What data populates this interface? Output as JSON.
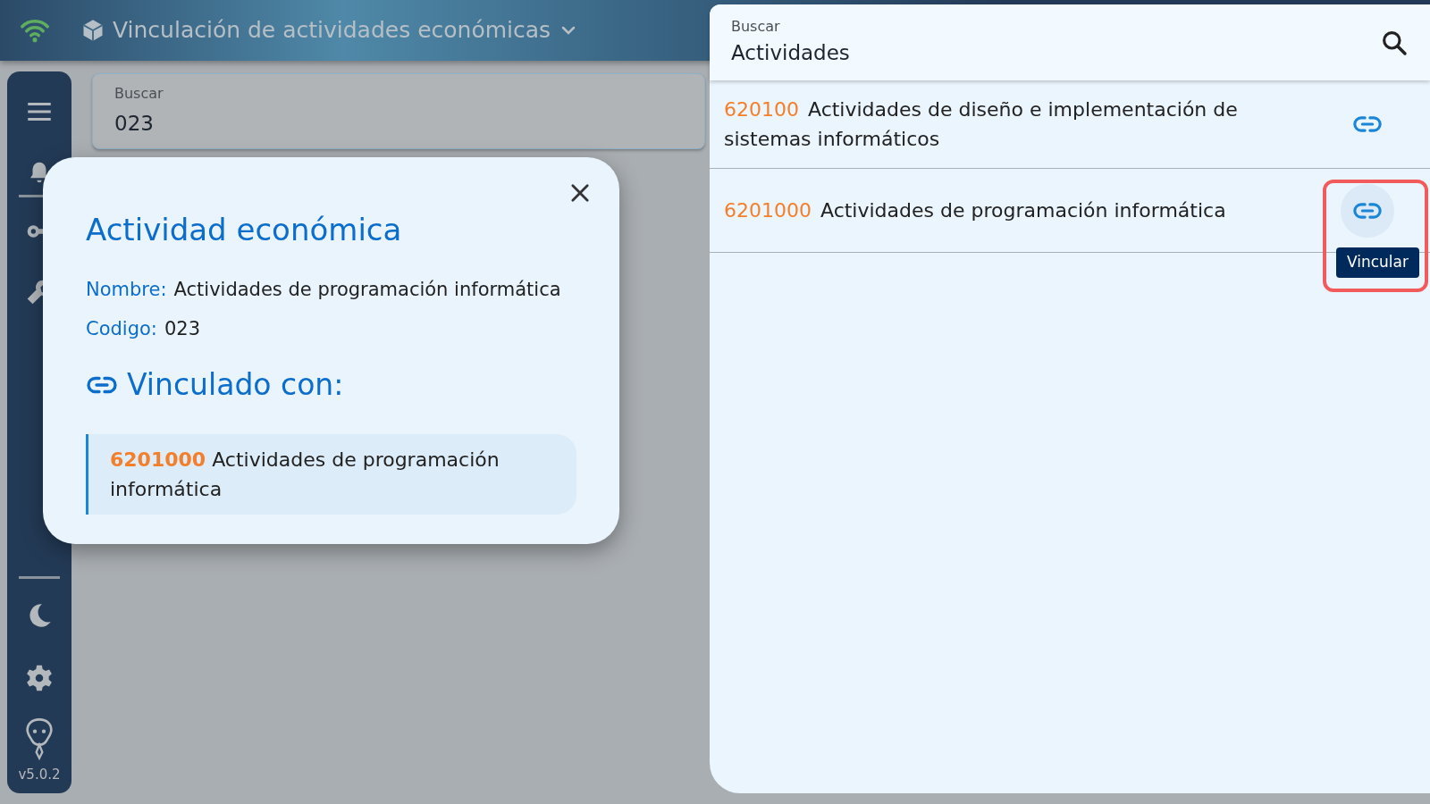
{
  "header": {
    "title": "Vinculación de actividades económicas"
  },
  "sidebar": {
    "version": "v5.0.2"
  },
  "search": {
    "label": "Buscar",
    "value": "023"
  },
  "dialog": {
    "title": "Actividad económica",
    "fields": [
      {
        "label": "Nombre:",
        "value": "Actividades de programación informática"
      },
      {
        "label": "Codigo:",
        "value": "023"
      }
    ],
    "linked_heading": "Vinculado con:",
    "linked": [
      {
        "code": "6201000",
        "name": "Actividades de programación informática"
      }
    ]
  },
  "panel": {
    "search": {
      "label": "Buscar",
      "value": "Actividades"
    },
    "results": [
      {
        "code": "620100",
        "name": "Actividades de diseño e implementación de sistemas informáticos",
        "hovered": false,
        "highlighted": false
      },
      {
        "code": "6201000",
        "name": "Actividades de programación informática",
        "hovered": true,
        "highlighted": true,
        "tooltip": "Vincular"
      }
    ]
  }
}
